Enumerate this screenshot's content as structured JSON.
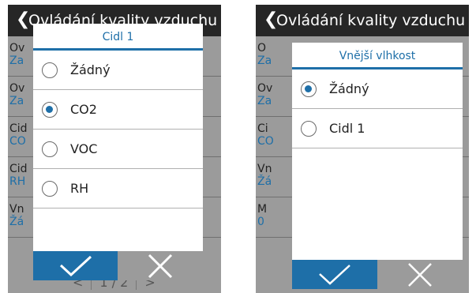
{
  "left_screen": {
    "header_title": "Ovládání kvality vzduchu",
    "background_rows": [
      {
        "label": "Ov",
        "value": "Za"
      },
      {
        "label": "Ov",
        "value": "Za"
      },
      {
        "label": "Cid",
        "value": "CO"
      },
      {
        "label": "Cid",
        "value": "RH"
      },
      {
        "label": "Vn",
        "value": "Žá"
      }
    ],
    "pager": {
      "page": "1 / 2",
      "prev_icon": "chevron-left-icon",
      "next_icon": "chevron-right-icon"
    },
    "dialog": {
      "title": "Cidl 1",
      "options": [
        {
          "label": "Žádný",
          "selected": false
        },
        {
          "label": "CO2",
          "selected": true
        },
        {
          "label": "VOC",
          "selected": false
        },
        {
          "label": "RH",
          "selected": false
        }
      ],
      "confirm_icon": "checkmark-icon",
      "cancel_icon": "close-icon"
    }
  },
  "right_screen": {
    "header_title": "Ovládání kvality vzduchu",
    "background_rows": [
      {
        "label": "O",
        "value": "Za"
      },
      {
        "label": "Ov",
        "value": "Za"
      },
      {
        "label": "Ci",
        "value": "CO"
      },
      {
        "label": "Vn",
        "value": "Žá"
      },
      {
        "label": "M",
        "value": "0"
      }
    ],
    "dialog": {
      "title": "Vnější vlhkost",
      "options": [
        {
          "label": "Žádný",
          "selected": true
        },
        {
          "label": "Cidl 1",
          "selected": false
        }
      ],
      "confirm_icon": "checkmark-icon",
      "cancel_icon": "close-icon"
    }
  },
  "colors": {
    "accent": "#1e6fa8",
    "header_bg": "#262626",
    "dim_bg": "#9b9b9b"
  }
}
